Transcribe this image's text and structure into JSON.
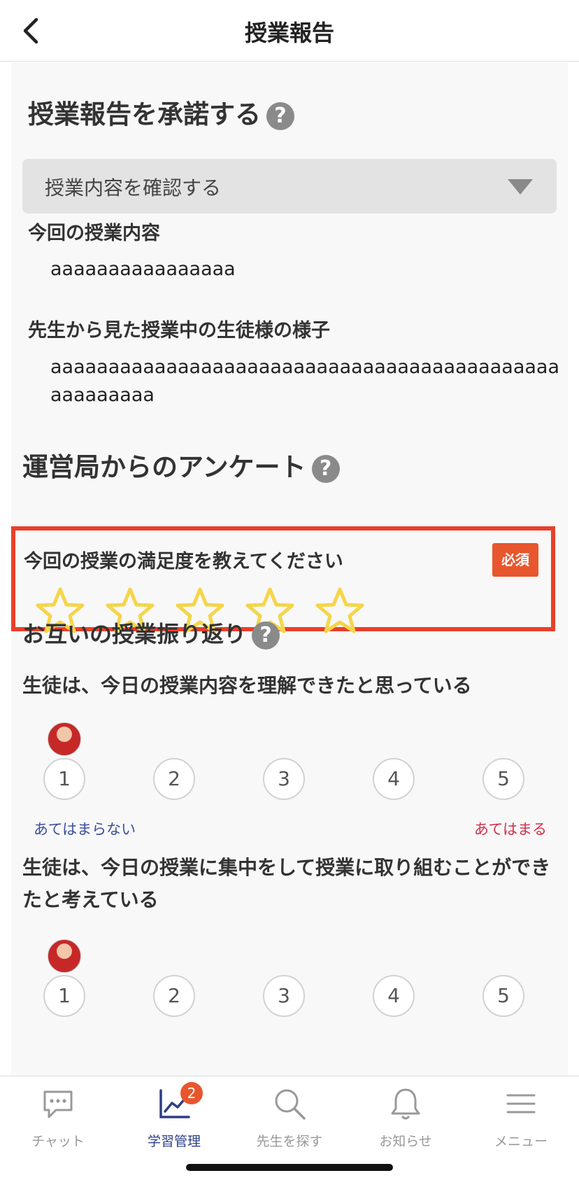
{
  "header": {
    "title": "授業報告"
  },
  "approve_section": {
    "title": "授業報告を承諾する",
    "help": "?",
    "dropdown_label": "授業内容を確認する"
  },
  "lesson": {
    "content_label": "今回の授業内容",
    "content_value": "aaaaaaaaaaaaaaaa",
    "observation_label": "先生から見た授業中の生徒様の様子",
    "observation_value": "aaaaaaaaaaaaaaaaaaaaaaaaaaaaaaaaaaaaaaaaaaaaaaaaaaaaa"
  },
  "survey": {
    "title": "運営局からのアンケート",
    "help": "?",
    "question": "今回の授業の満足度を教えてください",
    "required_badge": "必須",
    "rating_max": 5,
    "rating_value": 0,
    "star_color": "#f5d54a",
    "highlight_color": "#e8402a"
  },
  "reflection": {
    "title": "お互いの授業振り返り",
    "help": "?",
    "questions": [
      {
        "text": "生徒は、今日の授業内容を理解できたと思っている",
        "scale": [
          "1",
          "2",
          "3",
          "4",
          "5"
        ],
        "left_label": "あてはまらない",
        "right_label": "あてはまる"
      },
      {
        "text": "生徒は、今日の授業に集中をして授業に取り組むことができたと考えている",
        "scale": [
          "1",
          "2",
          "3",
          "4",
          "5"
        ]
      }
    ]
  },
  "tabbar": {
    "items": [
      {
        "label": "チャット",
        "icon": "chat-icon"
      },
      {
        "label": "学習管理",
        "icon": "chart-icon",
        "badge": "2",
        "active": true
      },
      {
        "label": "先生を探す",
        "icon": "search-icon"
      },
      {
        "label": "お知らせ",
        "icon": "bell-icon"
      },
      {
        "label": "メニュー",
        "icon": "menu-icon"
      }
    ],
    "active_color": "#2e3f86",
    "badge_color": "#e8562d"
  }
}
